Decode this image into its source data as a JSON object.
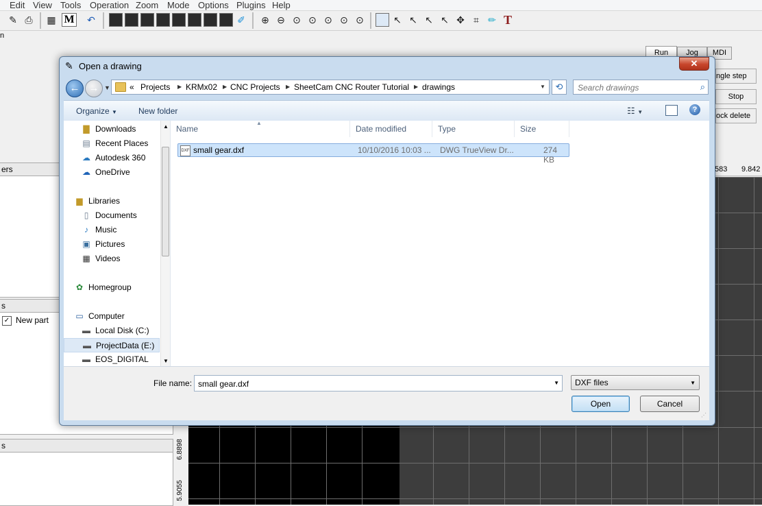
{
  "app": {
    "menu": [
      "Edit",
      "View",
      "Tools",
      "Operation",
      "Zoom",
      "Mode",
      "Options",
      "Plugins",
      "Help"
    ],
    "tabs": [
      "Run",
      "Jog",
      "MDI"
    ],
    "right_buttons": [
      "ngle step",
      "Stop",
      "ock delete"
    ],
    "coord_readout_1": "583",
    "coord_readout_2": "9.842",
    "panel_left_1": "ers",
    "panel_left_2": "s",
    "panel_left_3": "s",
    "part_item": "New part",
    "side_tick_1": "6.8898",
    "side_tick_2": "5.9055",
    "ruler_top_left": "n"
  },
  "dialog": {
    "title": "Open a drawing",
    "close_glyph": "✕",
    "breadcrumb": [
      "Projects",
      "KRMx02",
      "CNC Projects",
      "SheetCam CNC Router Tutorial",
      "drawings"
    ],
    "breadcrumb_prefix": "«",
    "search_placeholder": "Search drawings",
    "commands": {
      "organize": "Organize",
      "new_folder": "New folder"
    },
    "nav": [
      {
        "label": "Downloads",
        "icon": "downloads-icon"
      },
      {
        "label": "Recent Places",
        "icon": "recent-places-icon"
      },
      {
        "label": "Autodesk 360",
        "icon": "autodesk-icon"
      },
      {
        "label": "OneDrive",
        "icon": "onedrive-icon"
      },
      {
        "label": "Libraries",
        "icon": "libraries-icon"
      },
      {
        "label": "Documents",
        "icon": "documents-icon"
      },
      {
        "label": "Music",
        "icon": "music-icon"
      },
      {
        "label": "Pictures",
        "icon": "pictures-icon"
      },
      {
        "label": "Videos",
        "icon": "videos-icon"
      },
      {
        "label": "Homegroup",
        "icon": "homegroup-icon"
      },
      {
        "label": "Computer",
        "icon": "computer-icon"
      },
      {
        "label": "Local Disk (C:)",
        "icon": "local-disk-icon"
      },
      {
        "label": "ProjectData (E:)",
        "icon": "drive-icon"
      },
      {
        "label": "EOS_DIGITAL (F:)",
        "icon": "drive-icon"
      }
    ],
    "columns": [
      "Name",
      "Date modified",
      "Type",
      "Size"
    ],
    "files": [
      {
        "name": "small gear.dxf",
        "date": "10/10/2016 10:03 ...",
        "type": "DWG TrueView Dr...",
        "size": "274 KB",
        "icon": "dxf-file-icon"
      }
    ],
    "file_name_label": "File name:",
    "file_name_value": "small gear.dxf",
    "file_type": "DXF files",
    "open_label": "Open",
    "cancel_label": "Cancel"
  }
}
